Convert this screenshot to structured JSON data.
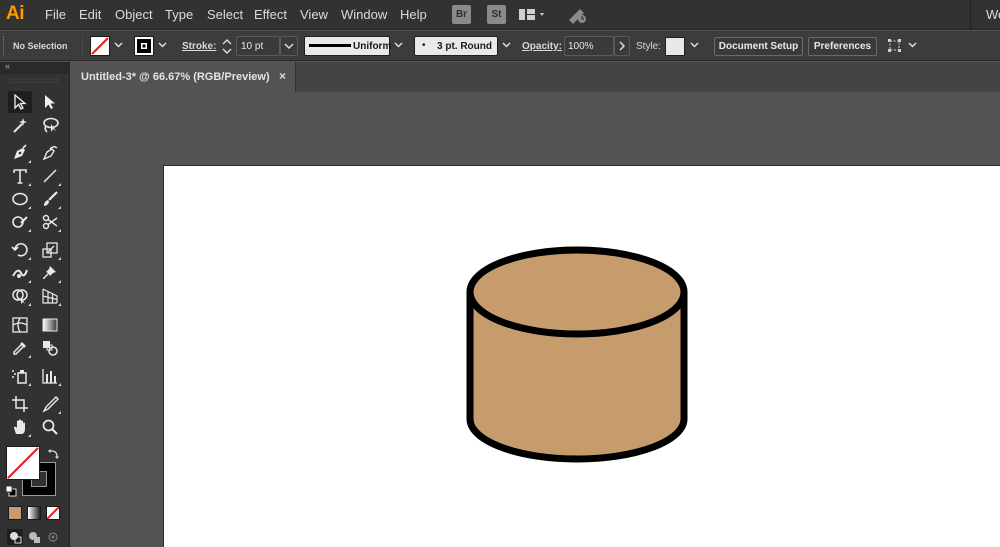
{
  "app": {
    "logo": "Ai"
  },
  "menubar": {
    "items": [
      "File",
      "Edit",
      "Object",
      "Type",
      "Select",
      "Effect",
      "View",
      "Window",
      "Help"
    ],
    "bridge_badge": "Br",
    "stock_badge": "St",
    "workspace_label": "We"
  },
  "controlbar": {
    "selection_status": "No Selection",
    "stroke_label": "Stroke:",
    "stroke_weight": "10 pt",
    "variable_width_profile": "Uniform",
    "brush_definition": "3 pt. Round",
    "opacity_label": "Opacity:",
    "opacity_value": "100%",
    "style_label": "Style:",
    "document_setup_label": "Document Setup",
    "preferences_label": "Preferences"
  },
  "document": {
    "tab_title": "Untitled-3* @ 66.67% (RGB/Preview)",
    "close_glyph": "×"
  },
  "tools_panel": {
    "collapse_glyph": "«"
  },
  "colors": {
    "cylinder_fill": "#c69c6d",
    "cylinder_stroke": "#000000",
    "app_logo": "#ff9a00",
    "stroke_none_red": "#e02020"
  },
  "swatches": {
    "color_mode": "#c69c6d"
  }
}
